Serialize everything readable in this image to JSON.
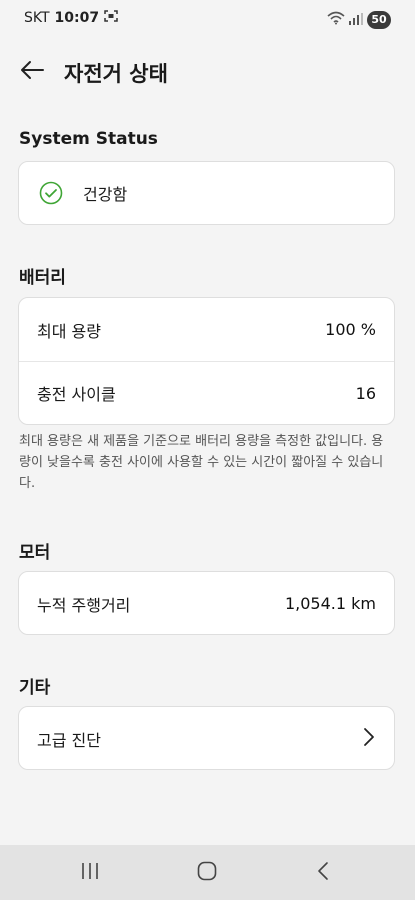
{
  "status_bar": {
    "carrier": "SKT",
    "time": "10:07",
    "battery": "50"
  },
  "header": {
    "title": "자전거 상태",
    "back_icon": "arrow-left-icon"
  },
  "system_status": {
    "heading": "System Status",
    "status": "건강함",
    "status_icon": "check-circle-icon",
    "accent": "#3fa535"
  },
  "battery": {
    "heading": "배터리",
    "rows": [
      {
        "label": "최대 용량",
        "value": "100 %"
      },
      {
        "label": "충전 사이클",
        "value": "16"
      }
    ],
    "note": "최대 용량은 새 제품을 기준으로 배터리 용량을 측정한 값입니다. 용량이 낮을수록 충전 사이에 사용할 수 있는 시간이 짧아질 수 있습니다."
  },
  "motor": {
    "heading": "모터",
    "rows": [
      {
        "label": "누적 주행거리",
        "value": "1,054.1 km"
      }
    ]
  },
  "etc": {
    "heading": "기타",
    "rows": [
      {
        "label": "고급 진단",
        "icon": "chevron-right-icon"
      }
    ]
  },
  "nav_bar": {
    "icons": [
      "recent-apps-icon",
      "home-icon",
      "back-icon"
    ]
  }
}
